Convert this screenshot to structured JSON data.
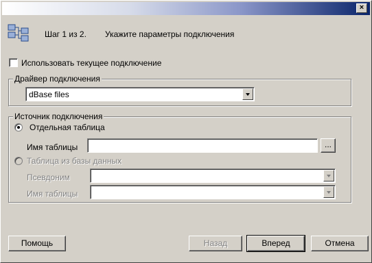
{
  "title_bar": {
    "close_label": "×"
  },
  "header": {
    "icon": "wizard-connection-icon",
    "step_text": "Шаг 1 из 2.",
    "instruction_text": "Укажите параметры подключения"
  },
  "use_current": {
    "label": "Использовать текущее подключение",
    "checked": false
  },
  "driver_group": {
    "legend": "Драйвер подключения",
    "selected_driver": "dBase files"
  },
  "source_group": {
    "legend": "Источник подключения",
    "single_table_label": "Отдельная таблица",
    "table_name_label": "Имя таблицы",
    "table_name_value": "",
    "browse_label": "...",
    "db_table_label": "Таблица из базы данных",
    "alias_label": "Псевдоним",
    "alias_value": "",
    "db_table_name_label": "Имя таблицы",
    "db_table_name_value": ""
  },
  "buttons": {
    "help": "Помощь",
    "back": "Назад",
    "next": "Вперед",
    "cancel": "Отмена"
  }
}
